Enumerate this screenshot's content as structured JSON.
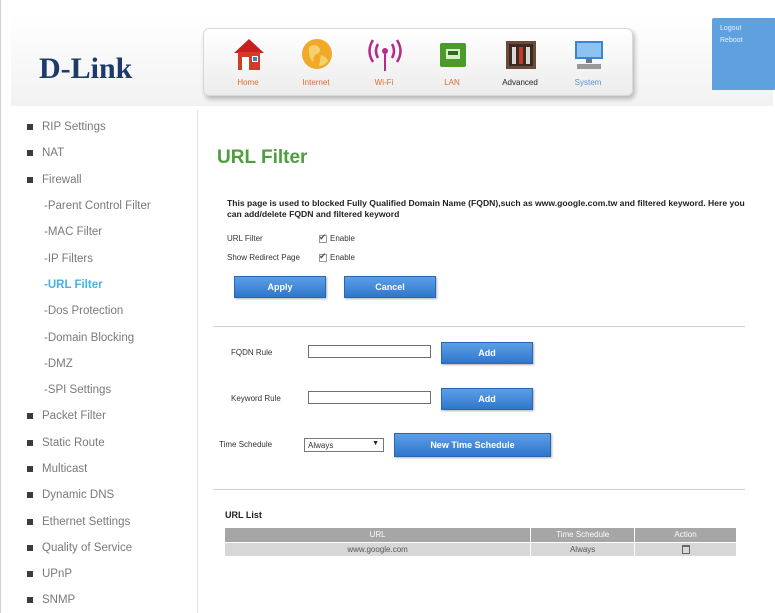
{
  "brand": {
    "logo_text": "D-Link"
  },
  "nav": {
    "items": [
      {
        "id": "home",
        "label": "Home",
        "icon": "home-icon"
      },
      {
        "id": "internet",
        "label": "Internet",
        "icon": "globe-icon"
      },
      {
        "id": "wifi",
        "label": "Wi-Fi",
        "icon": "wifi-icon"
      },
      {
        "id": "lan",
        "label": "LAN",
        "icon": "lan-icon"
      },
      {
        "id": "advanced",
        "label": "Advanced",
        "icon": "advanced-icon"
      },
      {
        "id": "system",
        "label": "System",
        "icon": "system-icon"
      }
    ],
    "active": "advanced"
  },
  "side_tab": {
    "logout": "Logout",
    "reboot": "Reboot"
  },
  "sidebar": {
    "items": [
      {
        "label": "RIP Settings",
        "type": "main"
      },
      {
        "label": "NAT",
        "type": "main"
      },
      {
        "label": "Firewall",
        "type": "main"
      },
      {
        "label": "-Parent Control Filter",
        "type": "sub"
      },
      {
        "label": "-MAC Filter",
        "type": "sub"
      },
      {
        "label": "-IP Filters",
        "type": "sub"
      },
      {
        "label": "-URL Filter",
        "type": "sub",
        "active": true
      },
      {
        "label": "-Dos Protection",
        "type": "sub"
      },
      {
        "label": "-Domain Blocking",
        "type": "sub"
      },
      {
        "label": "-DMZ",
        "type": "sub"
      },
      {
        "label": "-SPI Settings",
        "type": "sub"
      },
      {
        "label": "Packet Filter",
        "type": "main"
      },
      {
        "label": "Static Route",
        "type": "main"
      },
      {
        "label": "Multicast",
        "type": "main"
      },
      {
        "label": "Dynamic DNS",
        "type": "main"
      },
      {
        "label": "Ethernet Settings",
        "type": "main"
      },
      {
        "label": "Quality of Service",
        "type": "main"
      },
      {
        "label": "UPnP",
        "type": "main"
      },
      {
        "label": "SNMP",
        "type": "main"
      }
    ]
  },
  "main": {
    "title": "URL Filter",
    "description": "This page is used to blocked Fully Qualified Domain Name (FQDN),such as www.google.com.tw and filtered keyword. Here you can add/delete FQDN and filtered keyword",
    "url_filter_label": "URL Filter",
    "url_filter_enable": "Enable",
    "redirect_label": "Show Redirect Page",
    "redirect_enable": "Enable",
    "apply_label": "Apply",
    "cancel_label": "Cancel",
    "fqdn_label": "FQDN Rule",
    "fqdn_value": "",
    "fqdn_add_label": "Add",
    "keyword_label": "Keyword Rule",
    "keyword_value": "",
    "keyword_add_label": "Add",
    "schedule_label": "Time Schedule",
    "schedule_value": "Always",
    "new_schedule_label": "New Time Schedule"
  },
  "url_list": {
    "title": "URL List",
    "columns": [
      "URL",
      "Time Schedule",
      "Action"
    ],
    "rows": [
      {
        "url": "www.google.com",
        "schedule": "Always",
        "action_icon": "trash-icon"
      }
    ]
  },
  "colors": {
    "title_green": "#4c9e3e",
    "button_blue": "#3a85d6",
    "nav_label_orange": "#e06b2e",
    "side_tab_blue": "#5fa0de",
    "active_link": "#4ab0e8"
  }
}
